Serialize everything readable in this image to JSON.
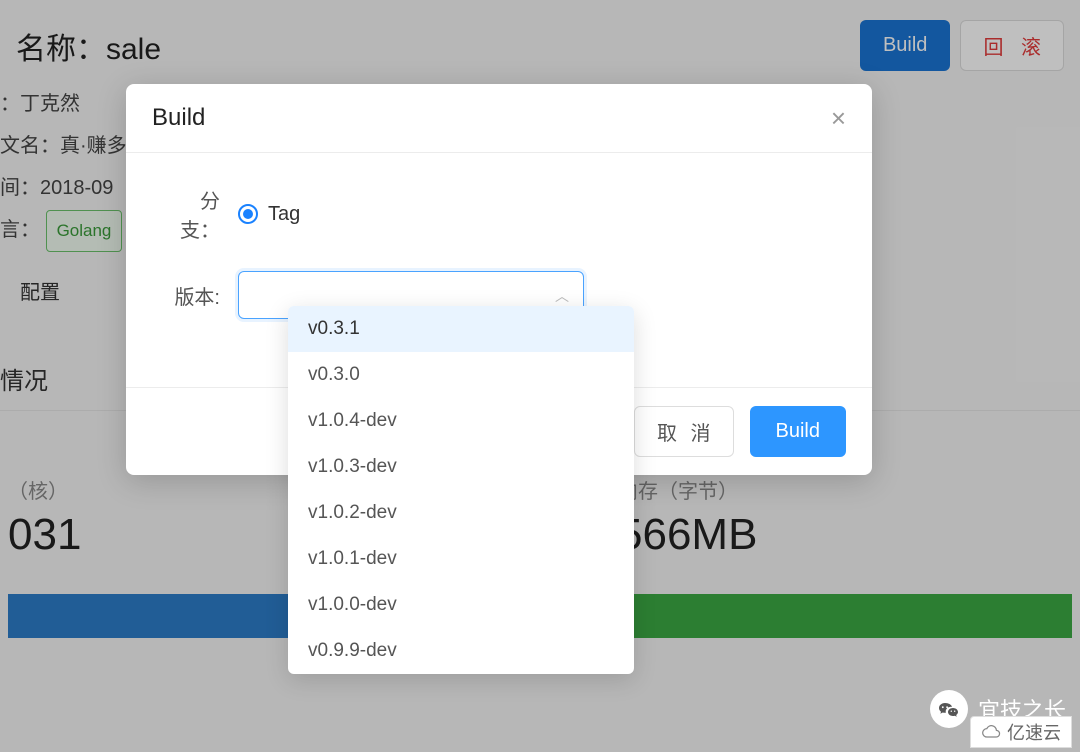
{
  "page": {
    "title_prefix": "名称：",
    "title_name": "sale",
    "buttons": {
      "build": "Build",
      "rollback": "回 滚"
    },
    "meta_creator_label_suffix": "：",
    "meta_creator_value": "丁克然",
    "meta_cnname_label": "文名：",
    "meta_cnname_value": "真·赚多",
    "meta_time_label": "间：",
    "meta_time_value": "2018-09",
    "meta_lang_label": "言：",
    "meta_lang_value": "Golang",
    "tab_config": "配置",
    "section_title_suffix": "情况",
    "cpu": {
      "label": "（核）",
      "value": "031"
    },
    "mem": {
      "label": "内存（字节）",
      "value": "566MB"
    }
  },
  "modal": {
    "title": "Build",
    "branch_label": "分支：",
    "tag_option": "Tag",
    "version_label": "版本:",
    "selected_version": "",
    "cancel_label": "取 消",
    "build_label": "Build"
  },
  "dropdown": {
    "highlighted_index": 0,
    "options": [
      "v0.3.1",
      "v0.3.0",
      "v1.0.4-dev",
      "v1.0.3-dev",
      "v1.0.2-dev",
      "v1.0.1-dev",
      "v1.0.0-dev",
      "v0.9.9-dev"
    ]
  },
  "footer": {
    "wechat_label": "宜技之长",
    "watermark": "亿速云"
  }
}
